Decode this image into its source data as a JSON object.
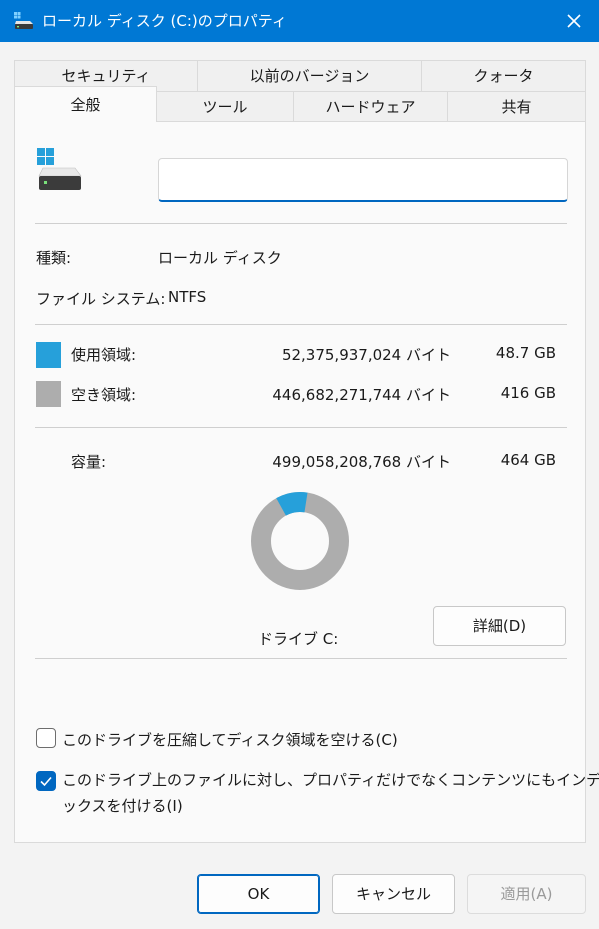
{
  "window": {
    "title": "ローカル ディスク (C:)のプロパティ"
  },
  "tabs_back": [
    "セキュリティ",
    "以前のバージョン",
    "クォータ"
  ],
  "tabs_front": [
    "全般",
    "ツール",
    "ハードウェア",
    "共有"
  ],
  "general": {
    "name_value": "",
    "type_label": "種類:",
    "type_value": "ローカル ディスク",
    "fs_label": "ファイル システム:",
    "fs_value": "NTFS",
    "used_label": "使用領域:",
    "used_bytes": "52,375,937,024 バイト",
    "used_size": "48.7 GB",
    "free_label": "空き領域:",
    "free_bytes": "446,682,271,744 バイト",
    "free_size": "416 GB",
    "capacity_label": "容量:",
    "capacity_bytes": "499,058,208,768 バイト",
    "capacity_size": "464 GB",
    "drive_label": "ドライブ C:",
    "details_button": "詳細(D)",
    "used_fraction": 0.105
  },
  "options": {
    "compress_label": "このドライブを圧縮してディスク領域を空ける(C)",
    "compress_checked": false,
    "index_label_line1": "このドライブ上のファイルに対し、プロパティだけでなくコンテンツにもインデ",
    "index_label_line2": "ックスを付ける(I)",
    "index_checked": true
  },
  "buttons": {
    "ok": "OK",
    "cancel": "キャンセル",
    "apply": "適用(A)"
  },
  "colors": {
    "titlebar": "#0078d4",
    "used": "#26a0da",
    "free": "#adadad",
    "accent": "#0067c0"
  }
}
